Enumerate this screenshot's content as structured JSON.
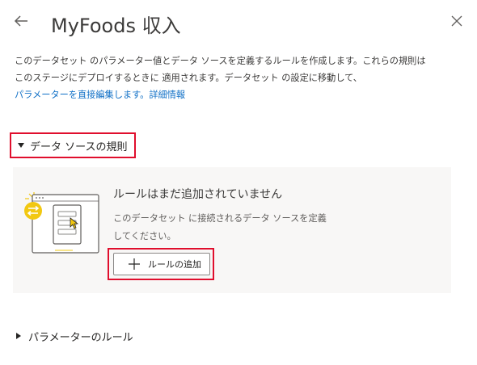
{
  "header": {
    "title": "MyFoods 収入",
    "back_icon": "arrow-left-icon",
    "close_icon": "close-icon"
  },
  "description": {
    "line1": "このデータセット のパラメーター値とデータ ソースを定義するルールを作成します。これらの規則は",
    "line2": "このステージにデプロイするときに 適用されます。データセット の設定に移動して、",
    "line3_text": "パラメーターを直接編集します。",
    "link": "詳細情報"
  },
  "sections": {
    "data_source_rules": {
      "label": "データ ソースの規則",
      "expanded": true
    },
    "parameter_rules": {
      "label": "パラメーターのルール",
      "expanded": false
    }
  },
  "empty_state": {
    "title": "ルールはまだ追加されていません",
    "desc_line1": "このデータセット に接続されるデータ ソースを定義",
    "desc_line2": "してください。",
    "add_button": "ルールの追加",
    "illustration": "rules-illustration"
  },
  "colors": {
    "highlight": "#e00e2d",
    "link": "#0f6fc6",
    "panel_bg": "#f8f7f6",
    "accent_yellow": "#f2c811"
  }
}
